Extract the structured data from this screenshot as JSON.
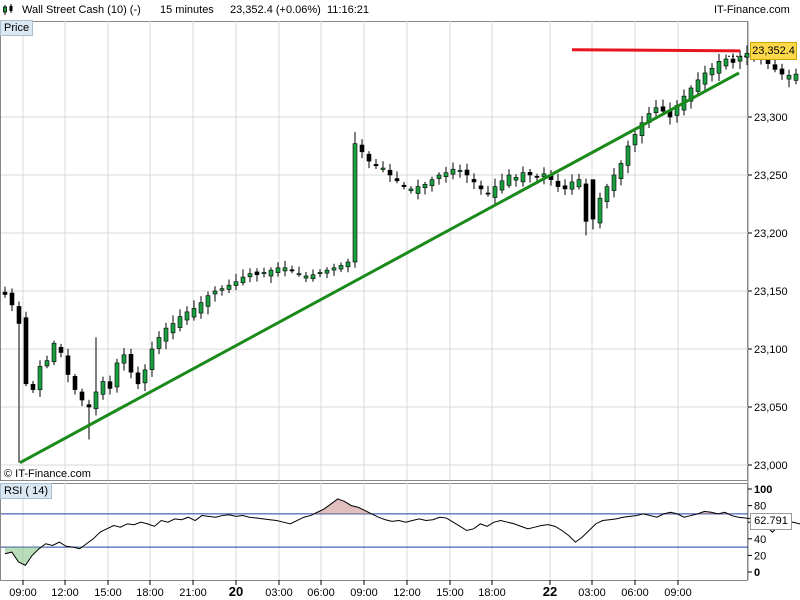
{
  "header": {
    "instrument": "Wall Street Cash (10) (-)",
    "timeframe": "15 minutes",
    "price_change": "23,352.4 (+0.06%)",
    "time": "11:16:21",
    "brand": "IT-Finance.com"
  },
  "price_panel": {
    "tag": "Price",
    "watermark": "© IT-Finance.com",
    "last_price_label": "23,352.4"
  },
  "rsi_panel": {
    "tag": "RSI ( 14)",
    "last_value_label": "62.791"
  },
  "colors": {
    "up": "#1a9e3f",
    "down": "#000000",
    "support_line": "#1a8a1a",
    "resistance_line": "#e8141e",
    "rsi_line": "#000000",
    "rsi_level": "#1f3f9f"
  },
  "chart_data": [
    {
      "type": "candlestick",
      "ylim": [
        23000,
        23400
      ],
      "y_ticks": [
        23000,
        23050,
        23100,
        23150,
        23200,
        23250,
        23300
      ],
      "y_tick_labels": [
        "23,000",
        "23,050",
        "23,100",
        "23,150",
        "23,200",
        "23,250",
        "23,300"
      ],
      "x_tick_labels": [
        "09:00",
        "12:00",
        "15:00",
        "18:00",
        "21:00",
        "20",
        "03:00",
        "06:00",
        "09:00",
        "12:00",
        "15:00",
        "18:00",
        "22",
        "03:00",
        "06:00",
        "09:00"
      ],
      "last_price": 23352.4,
      "close_path": [
        23147,
        23138,
        23122,
        23070,
        23065,
        23085,
        23090,
        23105,
        23097,
        23078,
        23065,
        23056,
        23050,
        23063,
        23072,
        23066,
        23088,
        23095,
        23080,
        23070,
        23082,
        23100,
        23110,
        23118,
        23122,
        23128,
        23132,
        23135,
        23140,
        23146,
        23150,
        23152,
        23155,
        23158,
        23162,
        23165,
        23164,
        23166,
        23168,
        23170,
        23170,
        23168,
        23165,
        23163,
        23164,
        23166,
        23168,
        23170,
        23172,
        23175,
        23277,
        23270,
        23262,
        23258,
        23256,
        23250,
        23245,
        23240,
        23238,
        23240,
        23242,
        23246,
        23250,
        23252,
        23255,
        23254,
        23250,
        23244,
        23238,
        23234,
        23240,
        23245,
        23250,
        23248,
        23252,
        23250,
        23248,
        23251,
        23246,
        23240,
        23238,
        23244,
        23246,
        23210,
        23212,
        23230,
        23240,
        23250,
        23260,
        23275,
        23285,
        23295,
        23303,
        23308,
        23305,
        23300,
        23310,
        23318,
        23325,
        23332,
        23338,
        23342,
        23348,
        23350,
        23347,
        23352,
        23355,
        23352,
        23350,
        23346,
        23341,
        23337,
        23336,
        23337,
        23338,
        23336,
        23335,
        23333,
        23329,
        23333,
        23338,
        23340,
        23337,
        23329,
        23323,
        23328,
        23335,
        23340,
        23342,
        23350,
        23352
      ],
      "support_line": {
        "start": [
          0,
          23002
        ],
        "end": [
          143,
          23338
        ]
      },
      "resistance_line": {
        "start": [
          112,
          23358
        ],
        "end": [
          144,
          23357
        ]
      }
    },
    {
      "type": "line",
      "name": "RSI ( 14)",
      "ylim": [
        0,
        100
      ],
      "y_ticks": [
        0,
        20,
        40,
        60,
        80,
        100
      ],
      "levels": [
        30,
        70
      ],
      "last_value": 62.791,
      "values": [
        22,
        24,
        12,
        8,
        20,
        28,
        34,
        32,
        36,
        31,
        30,
        28,
        34,
        40,
        48,
        52,
        56,
        54,
        58,
        57,
        60,
        58,
        55,
        62,
        60,
        64,
        63,
        66,
        62,
        68,
        67,
        66,
        68,
        69,
        67,
        68,
        66,
        65,
        64,
        63,
        62,
        60,
        58,
        62,
        66,
        68,
        72,
        76,
        82,
        88,
        85,
        80,
        78,
        74,
        70,
        66,
        63,
        61,
        62,
        60,
        62,
        64,
        62,
        63,
        66,
        65,
        60,
        55,
        50,
        52,
        58,
        55,
        60,
        62,
        60,
        58,
        55,
        52,
        54,
        56,
        57,
        55,
        50,
        44,
        36,
        42,
        50,
        58,
        62,
        63,
        64,
        66,
        67,
        68,
        70,
        68,
        66,
        70,
        72,
        70,
        66,
        68,
        70,
        73,
        72,
        70,
        72,
        68,
        66,
        65,
        64,
        62,
        56,
        48,
        56,
        58,
        60,
        58,
        57,
        54,
        50,
        48,
        52,
        56,
        60,
        58,
        54,
        46,
        40,
        48,
        56,
        58,
        60,
        63,
        62.8
      ]
    }
  ]
}
